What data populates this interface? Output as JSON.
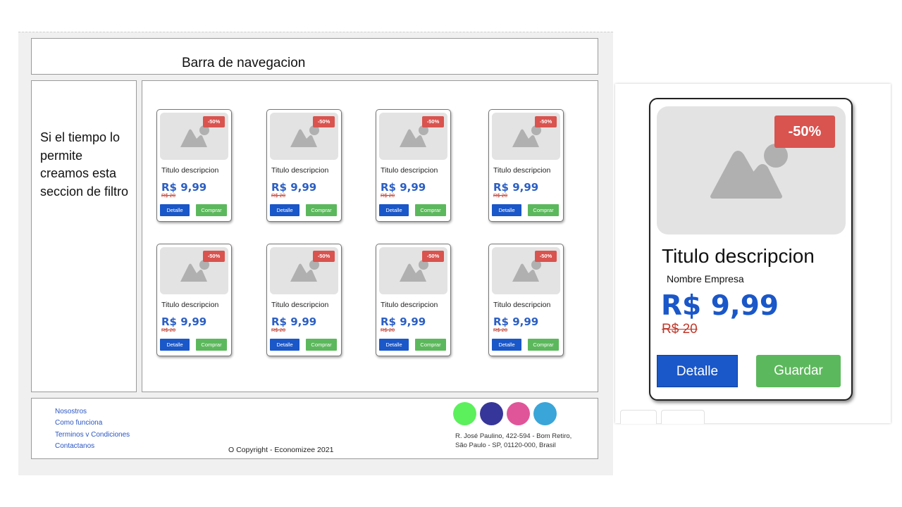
{
  "wireframe": {
    "navbar_title": "Barra de navegacion",
    "filter_text": "Si el tiempo lo permite creamos esta seccion de filtro",
    "cards": [
      {
        "badge": "-50%",
        "title": "Titulo descripcion",
        "price": "R$ 9,99",
        "old_price": "R$ 20",
        "detail_label": "Detalle",
        "buy_label": "Comprar"
      },
      {
        "badge": "-50%",
        "title": "Titulo descripcion",
        "price": "R$ 9,99",
        "old_price": "R$ 20",
        "detail_label": "Detalle",
        "buy_label": "Comprar"
      },
      {
        "badge": "-50%",
        "title": "Titulo descripcion",
        "price": "R$ 9,99",
        "old_price": "R$ 20",
        "detail_label": "Detalle",
        "buy_label": "Comprar"
      },
      {
        "badge": "-50%",
        "title": "Titulo descripcion",
        "price": "R$ 9,99",
        "old_price": "R$ 20",
        "detail_label": "Detalle",
        "buy_label": "Comprar"
      },
      {
        "badge": "-50%",
        "title": "Titulo descripcion",
        "price": "R$ 9,99",
        "old_price": "R$ 20",
        "detail_label": "Detalle",
        "buy_label": "Comprar"
      },
      {
        "badge": "-50%",
        "title": "Titulo descripcion",
        "price": "R$ 9,99",
        "old_price": "R$ 20",
        "detail_label": "Detalle",
        "buy_label": "Comprar"
      },
      {
        "badge": "-50%",
        "title": "Titulo descripcion",
        "price": "R$ 9,99",
        "old_price": "R$ 20",
        "detail_label": "Detalle",
        "buy_label": "Comprar"
      },
      {
        "badge": "-50%",
        "title": "Titulo descripcion",
        "price": "R$ 9,99",
        "old_price": "R$ 20",
        "detail_label": "Detalle",
        "buy_label": "Comprar"
      }
    ],
    "footer": {
      "links": [
        "Nosostros",
        "Como funciona",
        "Terminos v Condiciones",
        "Contactanos"
      ],
      "copyright": "O Copyright -  Economizee 2021",
      "address_line1": "R. José Paulino, 422-594 - Bom Retiro,",
      "address_line2": "São Paulo - SP, 01120-000, Brasil",
      "palette": [
        "#5cf05c",
        "#36369a",
        "#e0559a",
        "#3aa5d8"
      ]
    }
  },
  "detail_card": {
    "badge": "-50%",
    "title": "Titulo descripcion",
    "company": "Nombre Empresa",
    "price": "R$ 9,99",
    "old_price": "R$ 20",
    "detail_label": "Detalle",
    "save_label": "Guardar"
  },
  "colors": {
    "primary_blue": "#1a57c8",
    "success_green": "#5cb85c",
    "discount_red": "#d9534f",
    "price_blue": "#2b5fc4"
  }
}
